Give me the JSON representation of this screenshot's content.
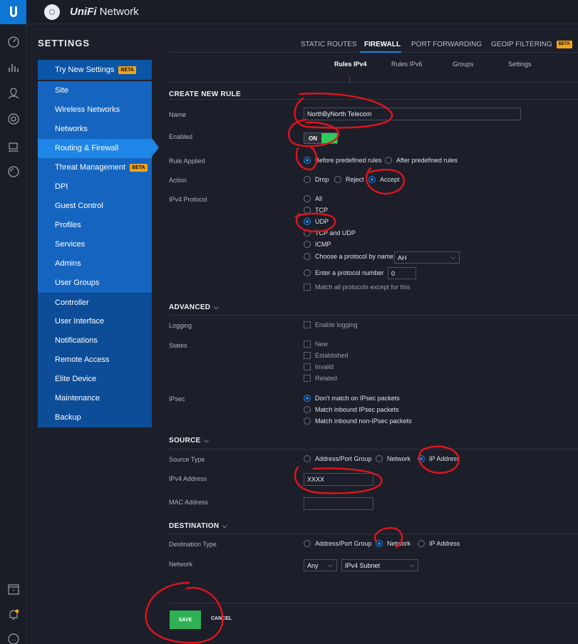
{
  "app": {
    "brand_prefix": "UniFi",
    "brand_suffix": "Network"
  },
  "colors": {
    "accent": "#1e86e6",
    "sidebar": "#1565c0",
    "save": "#2fb155",
    "annotation": "#e0141e"
  },
  "rail_icons": [
    "dashboard-icon",
    "statistics-icon",
    "map-icon",
    "devices-icon",
    "clients-icon",
    "insights-icon",
    "events-icon",
    "alerts-icon",
    "more-icon"
  ],
  "settings_title": "SETTINGS",
  "sidebar": {
    "items": [
      {
        "label": "Try New Settings",
        "badge": "BETA"
      },
      {
        "label": "Site"
      },
      {
        "label": "Wireless Networks"
      },
      {
        "label": "Networks"
      },
      {
        "label": "Routing & Firewall"
      },
      {
        "label": "Threat Management",
        "badge": "BETA"
      },
      {
        "label": "DPI"
      },
      {
        "label": "Guest Control"
      },
      {
        "label": "Profiles"
      },
      {
        "label": "Services"
      },
      {
        "label": "Admins"
      },
      {
        "label": "User Groups"
      },
      {
        "label": "Controller"
      },
      {
        "label": "User Interface"
      },
      {
        "label": "Notifications"
      },
      {
        "label": "Remote Access"
      },
      {
        "label": "Elite Device"
      },
      {
        "label": "Maintenance"
      },
      {
        "label": "Backup"
      }
    ],
    "active": "Routing & Firewall"
  },
  "tabs": [
    {
      "label": "STATIC ROUTES"
    },
    {
      "label": "FIREWALL"
    },
    {
      "label": "PORT FORWARDING"
    },
    {
      "label": "GEOIP FILTERING",
      "badge": "BETA"
    }
  ],
  "subtabs": [
    {
      "label": "Rules IPv4"
    },
    {
      "label": "Rules IPv6"
    },
    {
      "label": "Groups"
    },
    {
      "label": "Settings"
    }
  ],
  "create": {
    "heading": "CREATE NEW RULE",
    "name_label": "Name",
    "name_value": "NorthByNorth Telecom",
    "enabled_label": "Enabled",
    "enabled_value": "ON",
    "rule_applied_label": "Rule Applied",
    "rule_applied_options": [
      "Before predefined rules",
      "After predefined rules"
    ],
    "action_label": "Action",
    "action_options": [
      "Drop",
      "Reject",
      "Accept"
    ],
    "protocol_label": "IPv4 Protocol",
    "protocol_options": [
      "All",
      "TCP",
      "UDP",
      "TCP and UDP",
      "ICMP"
    ],
    "protocol_by_name": "Choose a protocol by name",
    "protocol_name_value": "AH",
    "protocol_by_number": "Enter a protocol number",
    "protocol_number_value": "0",
    "match_all_except": "Match all protocols except for this"
  },
  "advanced": {
    "heading": "ADVANCED",
    "logging_label": "Logging",
    "enable_logging": "Enable logging",
    "states_label": "States",
    "states": [
      "New",
      "Established",
      "Invalid",
      "Related"
    ],
    "ipsec_label": "IPsec",
    "ipsec_options": [
      "Don't match on IPsec packets",
      "Match inbound IPsec packets",
      "Match inbound non-IPsec packets"
    ]
  },
  "source": {
    "heading": "SOURCE",
    "type_label": "Source Type",
    "type_options": [
      "Address/Port Group",
      "Network",
      "IP Address"
    ],
    "ipv4_label": "IPv4 Address",
    "ipv4_value": "XXXX",
    "mac_label": "MAC Address",
    "mac_value": ""
  },
  "destination": {
    "heading": "DESTINATION",
    "type_label": "Destination Type",
    "type_options": [
      "Address/Port Group",
      "Network",
      "IP Address"
    ],
    "network_label": "Network",
    "network_select": "Any",
    "subnet_select": "IPv4 Subnet"
  },
  "actions": {
    "save": "SAVE",
    "cancel": "CANCEL"
  }
}
